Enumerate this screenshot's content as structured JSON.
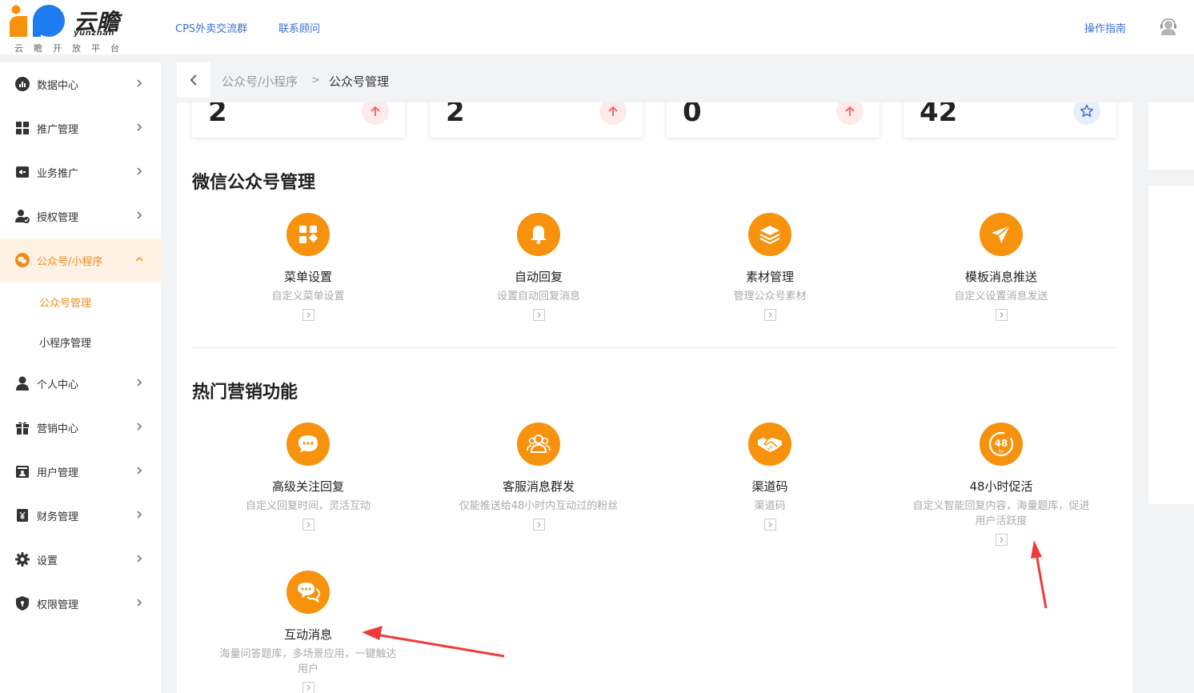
{
  "brand": {
    "name": "云瞻",
    "romanized": "yunzhan",
    "caption": "云瞻开放平台",
    "colors": {
      "orange": "#f7920d",
      "blue": "#1d7cf2",
      "accent": "#f08c1b",
      "link": "#3a6fd8"
    }
  },
  "topbar": {
    "links": [
      "CPS外卖交流群",
      "联系顾问"
    ],
    "guide": "操作指南",
    "avatar_icon": "user-avatar-icon"
  },
  "sidebar": {
    "items": [
      {
        "label": "数据中心",
        "icon": "chart-icon"
      },
      {
        "label": "推广管理",
        "icon": "grid-icon"
      },
      {
        "label": "业务推广",
        "icon": "megaphone-icon"
      },
      {
        "label": "授权管理",
        "icon": "user-check-icon"
      },
      {
        "label": "公众号/小程序",
        "icon": "wechat-icon",
        "expanded": true
      },
      {
        "label": "个人中心",
        "icon": "person-icon"
      },
      {
        "label": "营销中心",
        "icon": "gift-icon"
      },
      {
        "label": "用户管理",
        "icon": "id-card-icon"
      },
      {
        "label": "财务管理",
        "icon": "yuan-icon"
      },
      {
        "label": "设置",
        "icon": "gear-icon"
      },
      {
        "label": "权限管理",
        "icon": "shield-icon"
      }
    ],
    "subitems": [
      {
        "label": "公众号管理",
        "active": true
      },
      {
        "label": "小程序管理",
        "active": false
      }
    ]
  },
  "breadcrumb": {
    "parent": "公众号/小程序",
    "separator": ">",
    "current": "公众号管理"
  },
  "stats": [
    {
      "value": "2",
      "icon": "arrow-up-icon"
    },
    {
      "value": "2",
      "icon": "arrow-up-icon"
    },
    {
      "value": "0",
      "icon": "arrow-up-icon"
    },
    {
      "value": "42",
      "icon": "star-icon"
    }
  ],
  "wechat_section": {
    "title": "微信公众号管理",
    "features": [
      {
        "name": "菜单设置",
        "desc": "自定义菜单设置",
        "icon": "apps-icon"
      },
      {
        "name": "自动回复",
        "desc": "设置自动回复消息",
        "icon": "bell-icon"
      },
      {
        "name": "素材管理",
        "desc": "管理公众号素材",
        "icon": "layers-icon"
      },
      {
        "name": "模板消息推送",
        "desc": "自定义设置消息发送",
        "icon": "paper-plane-icon"
      }
    ]
  },
  "marketing_section": {
    "title": "热门营销功能",
    "features": [
      {
        "name": "高级关注回复",
        "desc": "自定义回复时间，灵活互动",
        "icon": "chat-bubble-icon"
      },
      {
        "name": "客服消息群发",
        "desc": "仅能推送给48小时内互动过的粉丝",
        "icon": "users-icon"
      },
      {
        "name": "渠道码",
        "desc": "渠道码",
        "icon": "handshake-icon"
      },
      {
        "name": "48小时促活",
        "desc": "自定义智能回复内容，海量题库，促进用户活跃度",
        "icon": "48hr-icon"
      },
      {
        "name": "互动消息",
        "desc": "海量问答题库，多场景应用，一键触达用户",
        "icon": "chat-dots-icon"
      }
    ]
  }
}
